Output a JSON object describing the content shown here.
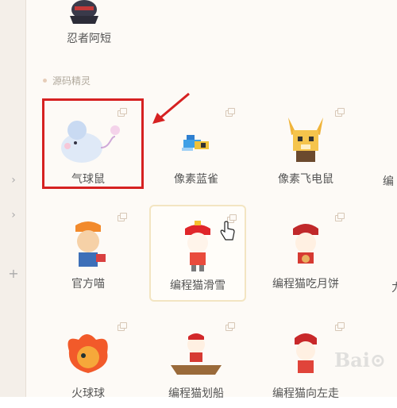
{
  "top_item": {
    "label": "忍者阿短"
  },
  "section": {
    "title": "源码精灵"
  },
  "tiles": [
    {
      "label": "气球鼠"
    },
    {
      "label": "像素蓝雀"
    },
    {
      "label": "像素飞电鼠"
    },
    {
      "label": "官方喵"
    },
    {
      "label": "编程猫滑雪"
    },
    {
      "label": "编程猫吃月饼"
    },
    {
      "label": "火球球"
    },
    {
      "label": "编程猫划船"
    },
    {
      "label": "编程猫向左走"
    }
  ],
  "partial_labels": {
    "row1": "编",
    "row2": "力"
  },
  "icons": {
    "rail": [
      "chevron-right-icon",
      "chevron-right-icon",
      "plus-icon"
    ],
    "copy": "copy-icon",
    "cursor": "hand-pointer-icon",
    "annotation": "red-arrow"
  },
  "colors": {
    "accent_red": "#d62121",
    "panel_bg": "#fdfaf6",
    "hover_border": "#f3e5c2"
  }
}
